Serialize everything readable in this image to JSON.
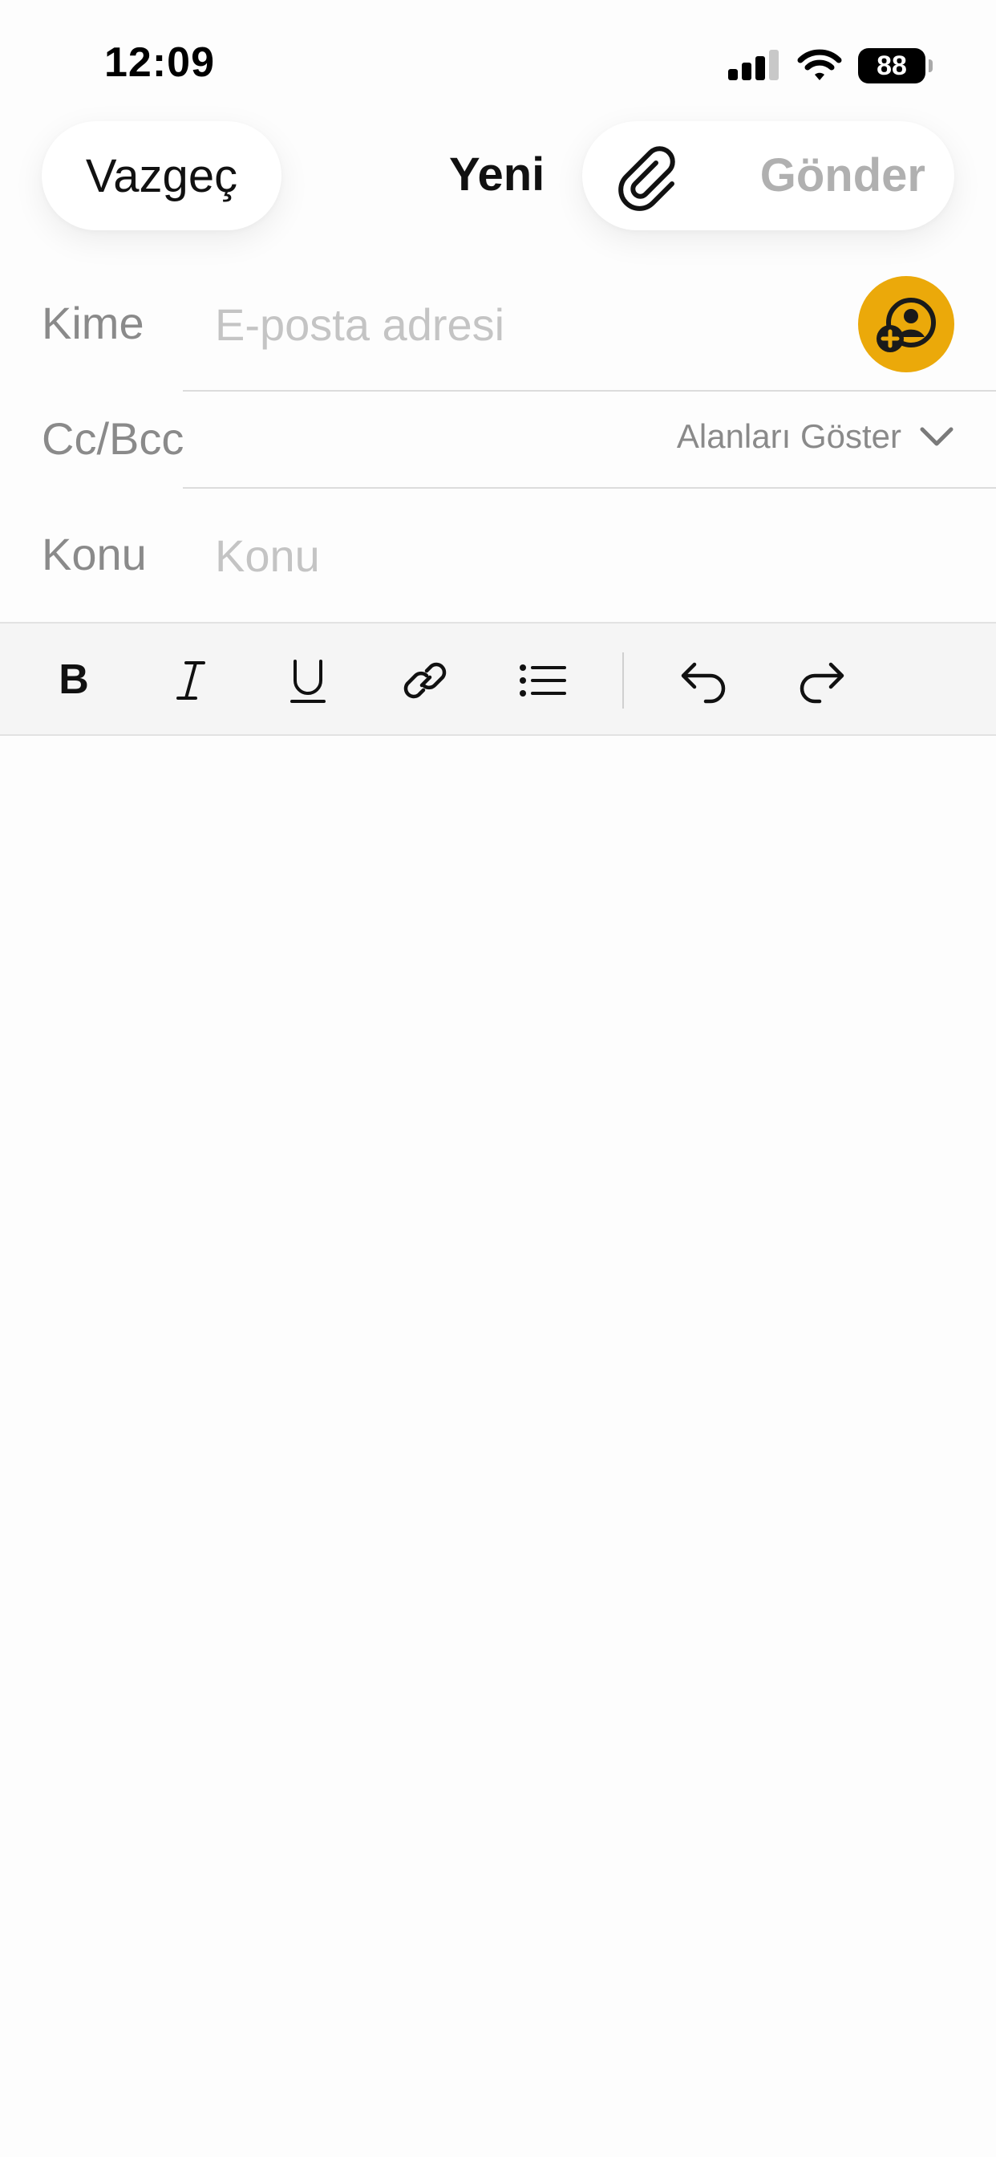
{
  "status_bar": {
    "time": "12:09",
    "battery": "88",
    "icons": [
      "cellular-signal-icon",
      "wifi-icon",
      "battery-icon"
    ]
  },
  "nav": {
    "cancel_label": "Vazgeç",
    "title": "Yeni",
    "send_label": "Gönder",
    "attach_icon": "paperclip-icon"
  },
  "fields": {
    "to": {
      "label": "Kime",
      "value": "",
      "placeholder": "E-posta adresi"
    },
    "cc_bcc": {
      "label": "Cc/Bcc",
      "toggle_label": "Alanları Göster"
    },
    "subject": {
      "label": "Konu",
      "value": "",
      "placeholder": "Konu"
    }
  },
  "toolbar": {
    "buttons": [
      "bold-icon",
      "italic-icon",
      "underline-icon",
      "link-icon",
      "bullet-list-icon",
      "undo-icon",
      "redo-icon"
    ]
  },
  "colors": {
    "accent": "#eba90a",
    "send_disabled": "#b0b0b0",
    "label": "#8a8a8a",
    "placeholder": "#c4c4c4",
    "toolbar_bg": "#f5f5f5"
  },
  "body": {
    "text": ""
  }
}
